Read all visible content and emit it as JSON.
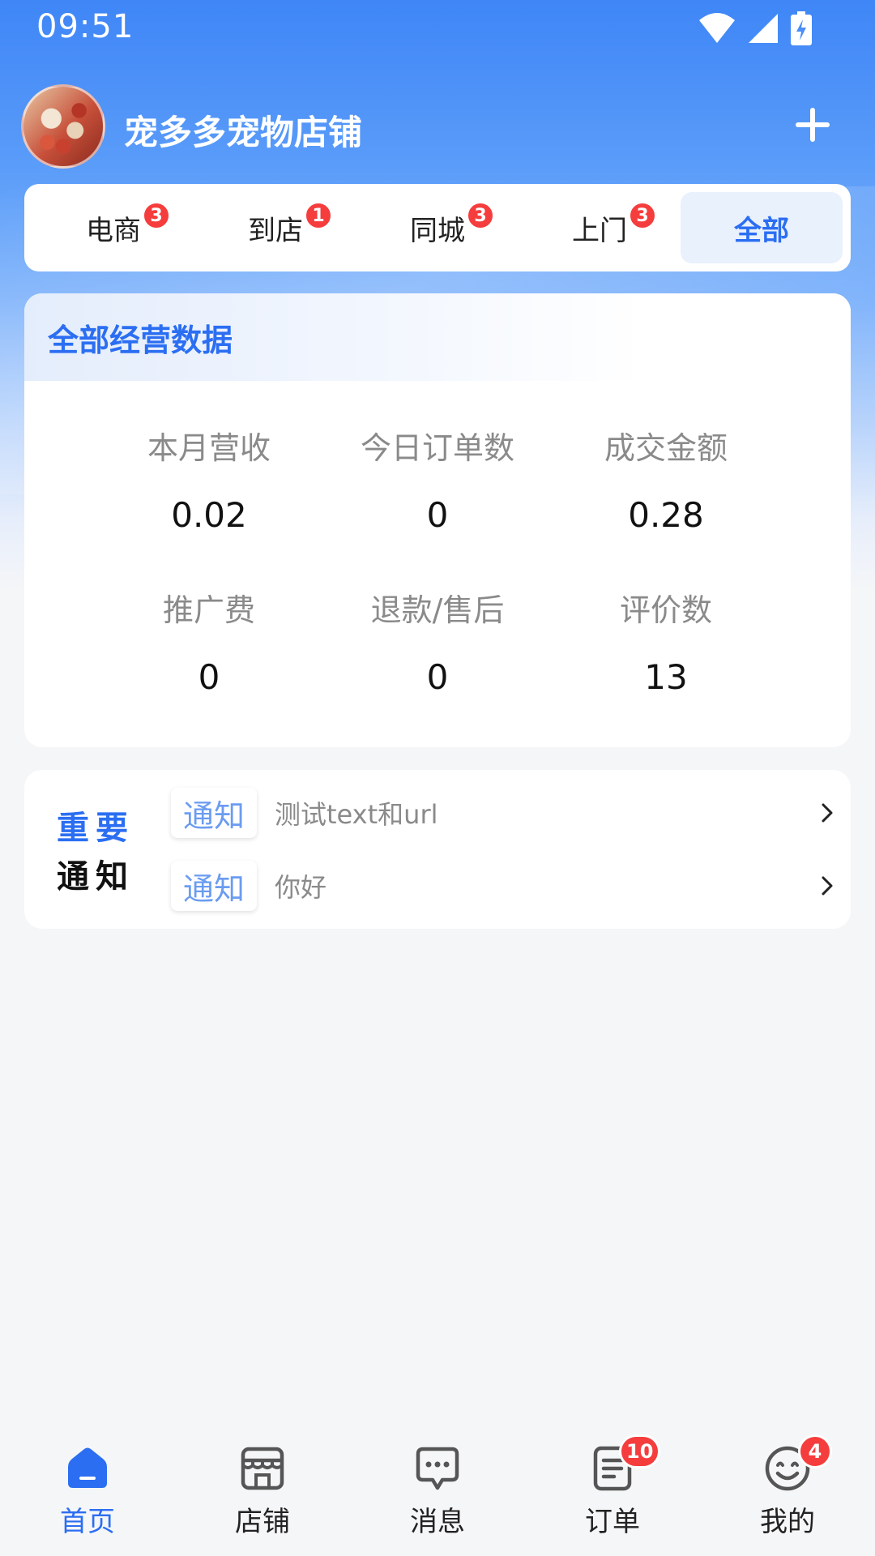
{
  "status_bar": {
    "time": "09:51"
  },
  "header": {
    "store_name": "宠多多宠物店铺"
  },
  "tabs": [
    {
      "label": "电商",
      "badge": "3"
    },
    {
      "label": "到店",
      "badge": "1"
    },
    {
      "label": "同城",
      "badge": "3"
    },
    {
      "label": "上门",
      "badge": "3"
    },
    {
      "label": "全部",
      "badge": ""
    }
  ],
  "stats": {
    "title": "全部经营数据",
    "items": [
      {
        "label": "本月营收",
        "value": "0.02"
      },
      {
        "label": "今日订单数",
        "value": "0"
      },
      {
        "label": "成交金额",
        "value": "0.28"
      },
      {
        "label": "推广费",
        "value": "0"
      },
      {
        "label": "退款/售后",
        "value": "0"
      },
      {
        "label": "评价数",
        "value": "13"
      }
    ]
  },
  "notices": {
    "logo_line1": "重要",
    "logo_line2": "通知",
    "items": [
      {
        "tag": "通知",
        "text": "测试text和url"
      },
      {
        "tag": "通知",
        "text": "你好"
      }
    ]
  },
  "bottom_nav": [
    {
      "label": "首页",
      "badge": ""
    },
    {
      "label": "店铺",
      "badge": ""
    },
    {
      "label": "消息",
      "badge": ""
    },
    {
      "label": "订单",
      "badge": "10"
    },
    {
      "label": "我的",
      "badge": "4"
    }
  ],
  "colors": {
    "brand": "#2b6ef2",
    "badge": "#f53d3d",
    "header": "#3f86f7"
  }
}
